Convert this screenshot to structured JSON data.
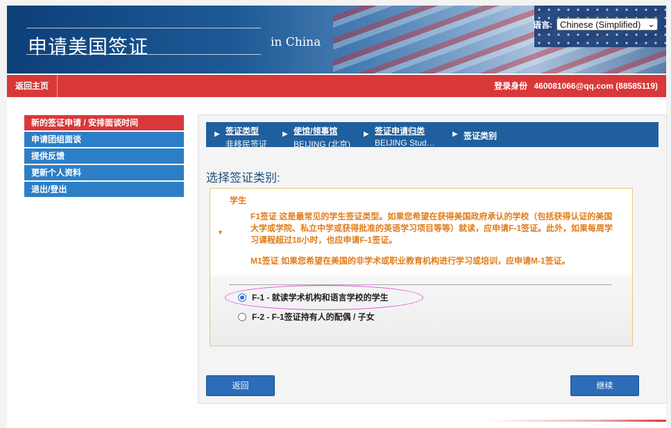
{
  "header": {
    "title": "申请美国签证",
    "subtitle": "in China",
    "language_label": "语言:",
    "language_value": "Chinese (Simplified)"
  },
  "navbar": {
    "home": "返回主页",
    "login_label": "登录身份",
    "login_value": "460081066@qq.com (88585119)"
  },
  "menu": {
    "items": [
      {
        "label": "新的签证申请 / 安排面谈时间"
      },
      {
        "label": "申请团组面谈"
      },
      {
        "label": "提供反馈"
      },
      {
        "label": "更新个人资料"
      },
      {
        "label": "退出/登出"
      }
    ]
  },
  "breadcrumb": [
    {
      "key": "签证类型",
      "value": "非移民签证"
    },
    {
      "key": "使馆/领事馆",
      "value": "BEIJING (北京)"
    },
    {
      "key": "签证申请归类",
      "value": "BEIJING Stud…"
    },
    {
      "key": "签证类别",
      "value": ""
    }
  ],
  "section_title": "选择签证类别:",
  "category": {
    "name": "学生",
    "desc1": "F1签证  这是最常见的学生签证类型。如果您希望在获得美国政府承认的学校（包括获得认证的美国大学或学院、私立中学或获得批准的英语学习项目等等）就读，应申请F-1签证。此外，如果每周学习课程超过18小时，也应申请F-1签证。",
    "desc2": "M1签证  如果您希望在美国的非学术或职业教育机构进行学习或培训，应申请M-1签证。"
  },
  "options": [
    {
      "label": "F-1 - 就读学术机构和语言学校的学生",
      "selected": true
    },
    {
      "label": "F-2 - F-1签证持有人的配偶 / 子女",
      "selected": false
    }
  ],
  "buttons": {
    "back": "返回",
    "continue": "继续"
  },
  "colors": {
    "nav_red": "#d9383a",
    "menu_blue": "#2c7fc7",
    "accent_orange": "#e07c1a",
    "highlight_magenta": "#e44ad9"
  }
}
